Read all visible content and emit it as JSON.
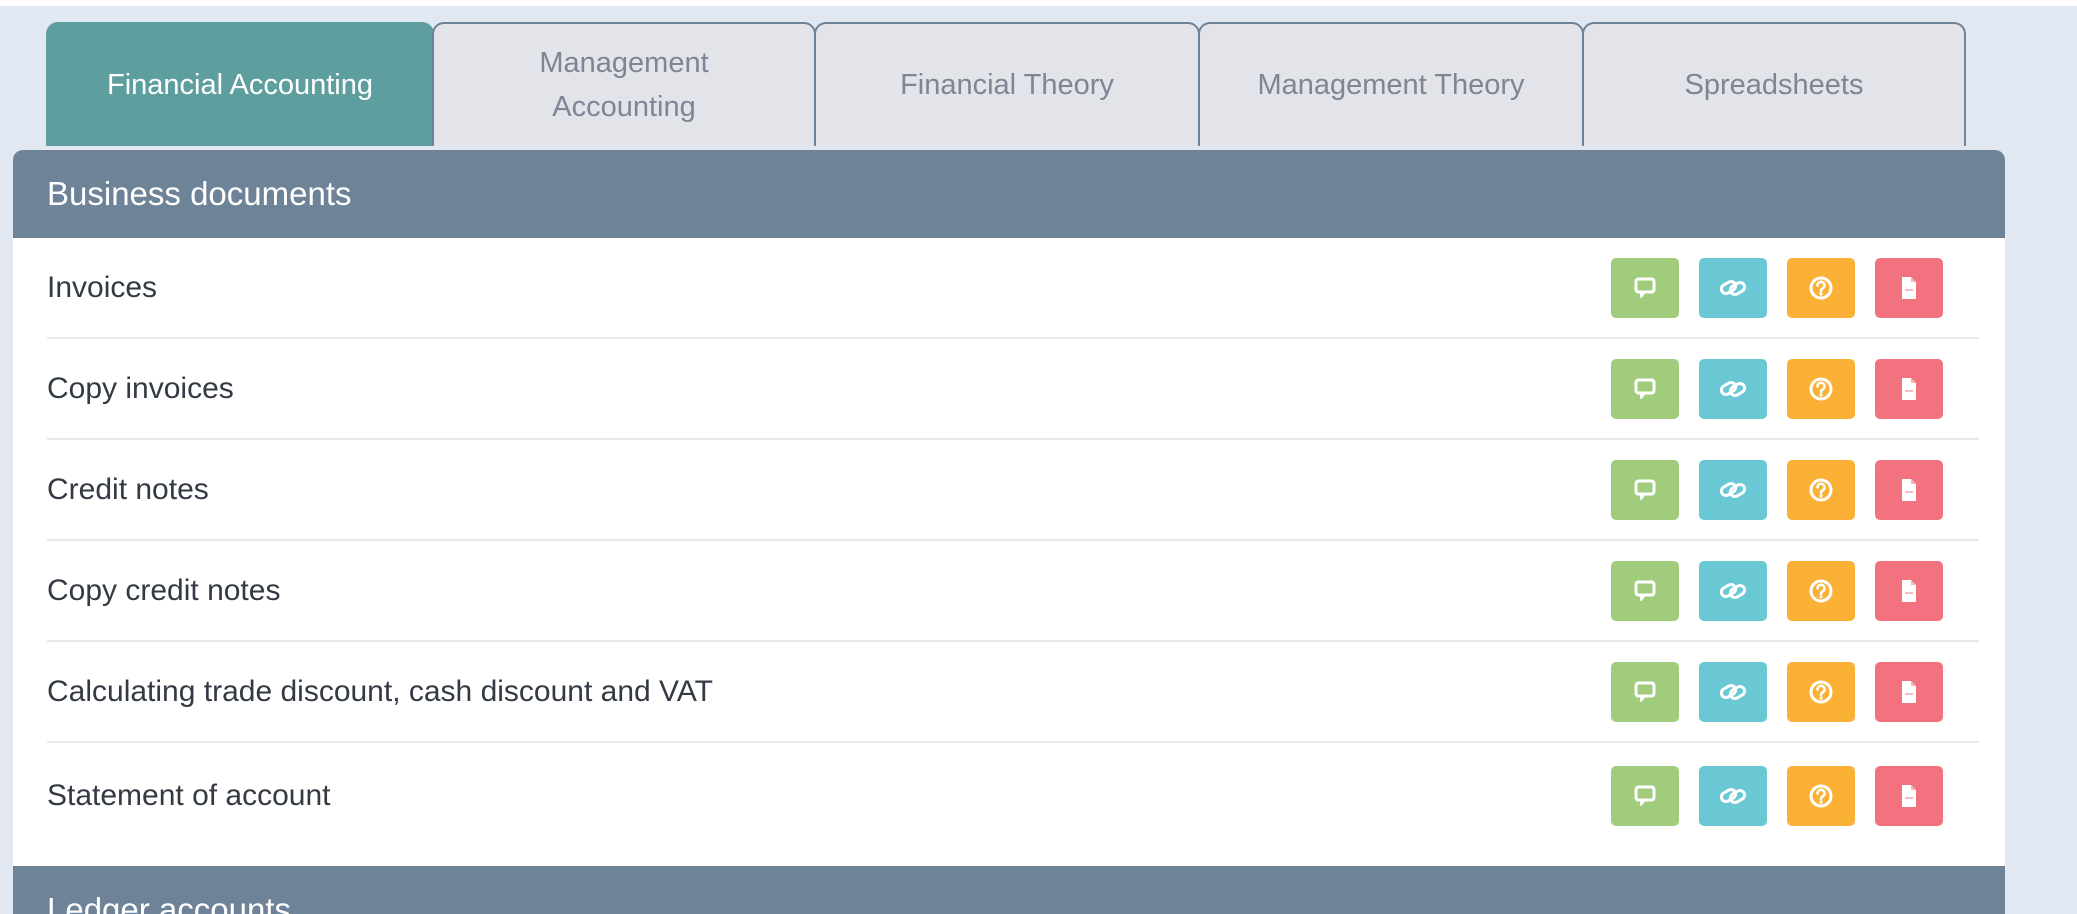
{
  "tabs": [
    {
      "label_line1": "Financial Accounting",
      "label_line2": "",
      "active": true
    },
    {
      "label_line1": "Management",
      "label_line2": "Accounting",
      "active": false
    },
    {
      "label_line1": "Financial Theory",
      "label_line2": "",
      "active": false
    },
    {
      "label_line1": "Management Theory",
      "label_line2": "",
      "active": false
    },
    {
      "label_line1": "Spreadsheets",
      "label_line2": "",
      "active": false
    }
  ],
  "sections": [
    {
      "title": "Business documents",
      "items": [
        "Invoices",
        "Copy invoices",
        "Credit notes",
        "Copy credit notes",
        "Calculating trade discount, cash discount and VAT",
        "Statement of account"
      ]
    },
    {
      "title": "Ledger accounts",
      "items": []
    }
  ],
  "action_icons": [
    "comment-icon",
    "link-icon",
    "help-icon",
    "document-icon"
  ],
  "colors": {
    "background": "#e2e8f1",
    "tab_active": "#5e9e9e",
    "tab_inactive": "#e3e4e9",
    "section_header": "#6e8398",
    "comment_button": "#a1cc7c",
    "link_button": "#69c8d4",
    "help_button": "#fbb136",
    "document_button": "#f2737f"
  }
}
